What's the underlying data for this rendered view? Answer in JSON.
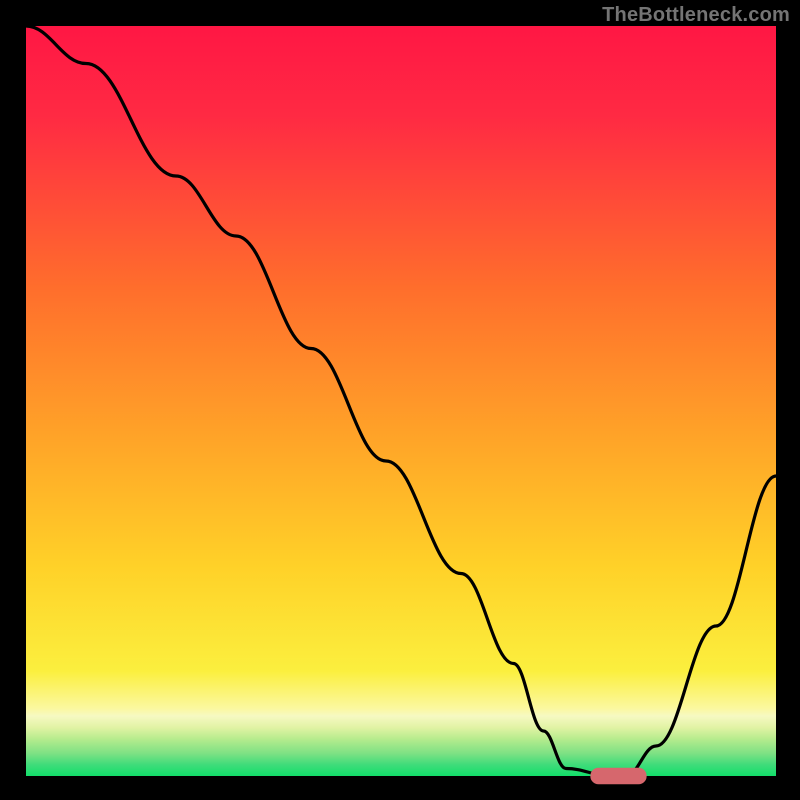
{
  "branding": "TheBottleneck.com",
  "chart_data": {
    "type": "line",
    "title": "",
    "xlabel": "",
    "ylabel": "",
    "xlim": [
      0,
      100
    ],
    "ylim": [
      0,
      100
    ],
    "grid": false,
    "series": [
      {
        "name": "curve",
        "x": [
          0,
          8,
          20,
          28,
          38,
          48,
          58,
          65,
          69,
          72,
          78,
          80,
          84,
          92,
          100
        ],
        "y": [
          100,
          95,
          80,
          72,
          57,
          42,
          27,
          15,
          6,
          1,
          0,
          0,
          4,
          20,
          40
        ]
      }
    ],
    "marker": {
      "x": 79,
      "y": 0,
      "color": "#d6676d",
      "width": 7.5,
      "height": 2.2
    },
    "gradient_bands": [
      {
        "y_from": 100,
        "y_to": 40,
        "color_top": "#ff1744",
        "color_bottom": "#ff8a2a"
      },
      {
        "y_from": 40,
        "y_to": 12,
        "color_top": "#ff8a2a",
        "color_bottom": "#ffe229"
      },
      {
        "y_from": 12,
        "y_to": 6,
        "color_top": "#ffe229",
        "color_bottom": "#faf9a3"
      },
      {
        "y_from": 6,
        "y_to": 2,
        "color_top": "#faf9a3",
        "color_bottom": "#8de38a"
      },
      {
        "y_from": 2,
        "y_to": 0,
        "color_top": "#8de38a",
        "color_bottom": "#15e06a"
      }
    ],
    "colors": {
      "background": "#000000",
      "curve": "#000000"
    }
  }
}
